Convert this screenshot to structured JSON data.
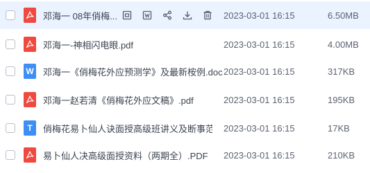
{
  "colors": {
    "pdf": "#f0493f",
    "doc": "#3d8ef5",
    "txt": "#3d8ef5",
    "hover_row": "#eaf3ff"
  },
  "actions": [
    "open-icon",
    "wps-icon",
    "share-icon",
    "download-icon",
    "delete-icon"
  ],
  "files": [
    {
      "name": "邓海一 08年俏梅...",
      "type": "pdf",
      "icon": "pdf-icon",
      "date": "2023-03-01 16:15",
      "size": "6.50MB"
    },
    {
      "name": "邓海一-神相闪电眼.pdf",
      "type": "pdf",
      "icon": "pdf-icon",
      "date": "2023-03-01 16:15",
      "size": "4.00MB"
    },
    {
      "name": "邓海一《俏梅花外应预测学》及最新桉例.doc",
      "type": "doc",
      "icon": "word-icon",
      "icon_letter": "W",
      "date": "2023-03-01 16:15",
      "size": "317KB"
    },
    {
      "name": "邓海一赵若清《俏梅花外应文稿》.pdf",
      "type": "pdf",
      "icon": "pdf-icon",
      "date": "2023-03-01 16:15",
      "size": "195KB"
    },
    {
      "name": "俏梅花易卜仙人诀面授高级班讲义及断事范...",
      "type": "txt",
      "icon": "text-icon",
      "icon_letter": "T",
      "date": "2023-03-01 16:15",
      "size": "17KB"
    },
    {
      "name": "易卜仙人决高级面授资料（两期全）.PDF",
      "type": "pdf",
      "icon": "pdf-icon",
      "date": "2023-03-01 16:15",
      "size": "210KB"
    }
  ]
}
